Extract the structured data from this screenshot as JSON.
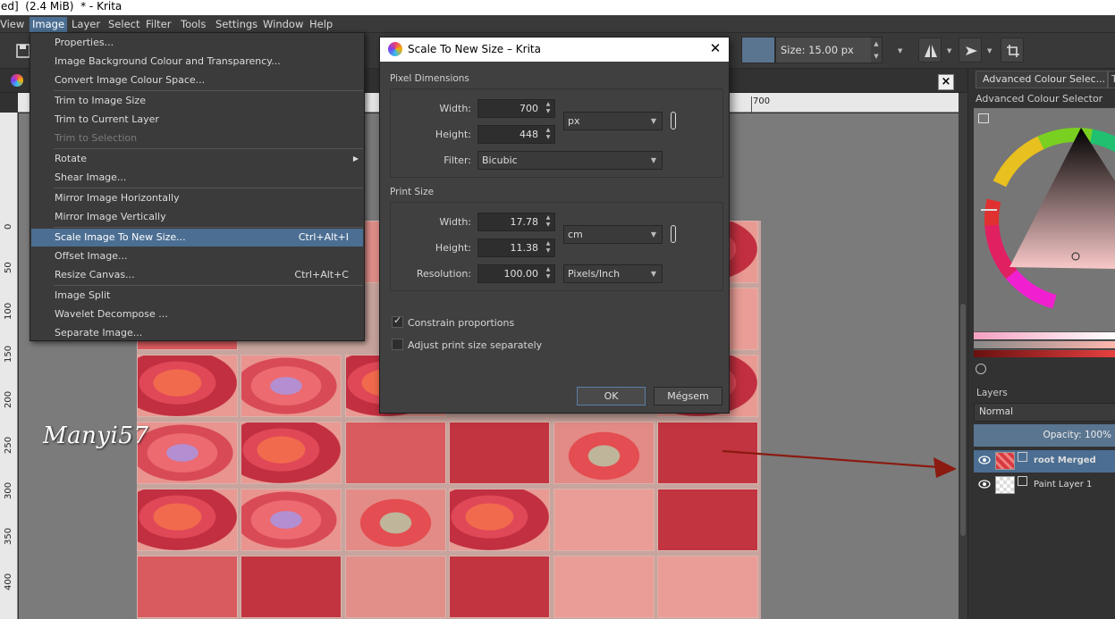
{
  "window": {
    "title": "ed]  (2.4 MiB)  * - Krita"
  },
  "menubar": [
    "View",
    "Image",
    "Layer",
    "Select",
    "Filter",
    "Tools",
    "Settings",
    "Window",
    "Help"
  ],
  "toolbar": {
    "size_label": "Size: 15.00 px"
  },
  "ruler": {
    "h_label": "700",
    "v_ticks": [
      "0",
      "50",
      "100",
      "150",
      "200",
      "250",
      "300",
      "350",
      "400"
    ]
  },
  "canvas": {
    "watermark": "Manyi57"
  },
  "image_menu": {
    "items": [
      {
        "label": "Properties..."
      },
      {
        "label": "Image Background Colour and Transparency..."
      },
      {
        "label": "Convert Image Colour Space..."
      },
      {
        "label": "Trim to Image Size"
      },
      {
        "label": "Trim to Current Layer"
      },
      {
        "label": "Trim to Selection"
      },
      {
        "label": "Rotate"
      },
      {
        "label": "Shear Image..."
      },
      {
        "label": "Mirror Image Horizontally"
      },
      {
        "label": "Mirror Image Vertically"
      },
      {
        "label": "Scale Image To New Size...",
        "shortcut": "Ctrl+Alt+I"
      },
      {
        "label": "Offset Image..."
      },
      {
        "label": "Resize Canvas...",
        "shortcut": "Ctrl+Alt+C"
      },
      {
        "label": "Image Split"
      },
      {
        "label": "Wavelet Decompose ..."
      },
      {
        "label": "Separate Image..."
      }
    ]
  },
  "dialog": {
    "title": "Scale To New Size – Krita",
    "pixel_dimensions": {
      "label": "Pixel Dimensions",
      "width_label": "Width:",
      "width": "700",
      "height_label": "Height:",
      "height": "448",
      "unit": "px",
      "filter_label": "Filter:",
      "filter": "Bicubic"
    },
    "print_size": {
      "label": "Print Size",
      "width_label": "Width:",
      "width": "17.78",
      "height_label": "Height:",
      "height": "11.38",
      "unit": "cm",
      "resolution_label": "Resolution:",
      "resolution": "100.00",
      "resolution_unit": "Pixels/Inch"
    },
    "constrain_label": "Constrain proportions",
    "constrain_checked": true,
    "adjust_label": "Adjust print size separately",
    "adjust_checked": false,
    "ok_label": "OK",
    "cancel_label": "Mégsem"
  },
  "dock": {
    "tab1": "Advanced Colour Selec...",
    "tab2": "T",
    "title": "Advanced Colour Selector",
    "layers_title": "Layers",
    "blend_mode": "Normal",
    "opacity": "Opacity:  100%",
    "layers": [
      {
        "name": "root Merged",
        "selected": true
      },
      {
        "name": "Paint Layer 1",
        "selected": false
      }
    ]
  },
  "colors": {
    "accent": "#4b6e92",
    "annotation_arrow": "#8b1a10"
  }
}
